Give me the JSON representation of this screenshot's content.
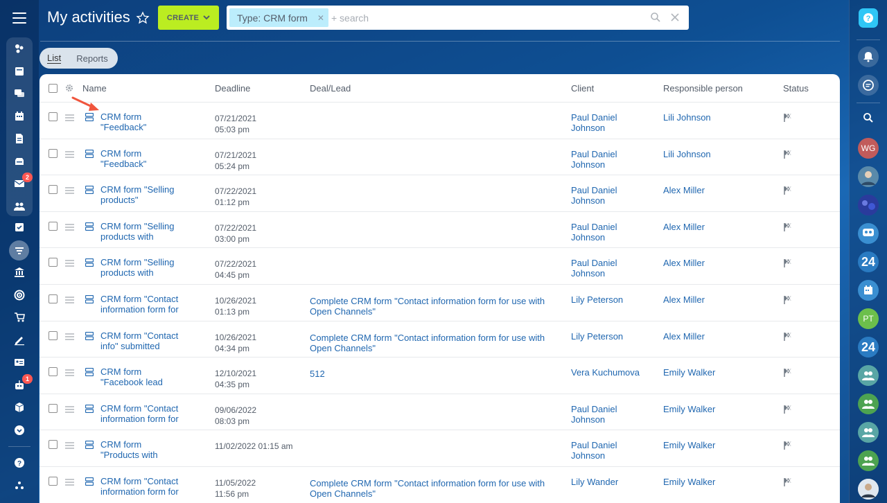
{
  "header": {
    "title": "My activities",
    "create_label": "CREATE",
    "filter_tag": "Type: CRM form",
    "search_placeholder": "+ search"
  },
  "view_tabs": [
    {
      "label": "List",
      "active": true
    },
    {
      "label": "Reports",
      "active": false
    }
  ],
  "columns": [
    "Name",
    "Deadline",
    "Deal/Lead",
    "Client",
    "Responsible person",
    "Status"
  ],
  "rows": [
    {
      "name": [
        "CRM form",
        "\"Feedback\""
      ],
      "deadline": [
        "07/21/2021",
        "05:03 pm"
      ],
      "deal": [
        "",
        ""
      ],
      "client": [
        "Paul Daniel",
        "Johnson"
      ],
      "responsible": "Lili Johnson"
    },
    {
      "name": [
        "CRM form",
        "\"Feedback\""
      ],
      "deadline": [
        "07/21/2021",
        "05:24 pm"
      ],
      "deal": [
        "",
        ""
      ],
      "client": [
        "Paul Daniel",
        "Johnson"
      ],
      "responsible": "Lili Johnson"
    },
    {
      "name": [
        "CRM form \"Selling",
        "products\""
      ],
      "deadline": [
        "07/22/2021",
        "01:12 pm"
      ],
      "deal": [
        "",
        ""
      ],
      "client": [
        "Paul Daniel",
        "Johnson"
      ],
      "responsible": "Alex Miller"
    },
    {
      "name": [
        "CRM form \"Selling",
        "products with"
      ],
      "deadline": [
        "07/22/2021",
        "03:00 pm"
      ],
      "deal": [
        "",
        ""
      ],
      "client": [
        "Paul Daniel",
        "Johnson"
      ],
      "responsible": "Alex Miller"
    },
    {
      "name": [
        "CRM form \"Selling",
        "products with"
      ],
      "deadline": [
        "07/22/2021",
        "04:45 pm"
      ],
      "deal": [
        "",
        ""
      ],
      "client": [
        "Paul Daniel",
        "Johnson"
      ],
      "responsible": "Alex Miller"
    },
    {
      "name": [
        "CRM form \"Contact",
        "information form for"
      ],
      "deadline": [
        "10/26/2021",
        "01:13 pm"
      ],
      "deal": [
        "Complete CRM form \"Contact information form for use with",
        "Open Channels\""
      ],
      "client": [
        "Lily Peterson",
        ""
      ],
      "responsible": "Alex Miller"
    },
    {
      "name": [
        "CRM form \"Contact",
        "info\" submitted"
      ],
      "deadline": [
        "10/26/2021",
        "04:34 pm"
      ],
      "deal": [
        "Complete CRM form \"Contact information form for use with",
        "Open Channels\""
      ],
      "client": [
        "Lily Peterson",
        ""
      ],
      "responsible": "Alex Miller"
    },
    {
      "name": [
        "CRM form",
        "\"Facebook lead"
      ],
      "deadline": [
        "12/10/2021",
        "04:35 pm"
      ],
      "deal": [
        "512",
        ""
      ],
      "client": [
        "Vera Kuchumova",
        ""
      ],
      "responsible": "Emily Walker"
    },
    {
      "name": [
        "CRM form \"Contact",
        "information form for"
      ],
      "deadline": [
        "09/06/2022",
        "08:03 pm"
      ],
      "deal": [
        "",
        ""
      ],
      "client": [
        "Paul Daniel",
        "Johnson"
      ],
      "responsible": "Emily Walker"
    },
    {
      "name": [
        "CRM form",
        "\"Products with"
      ],
      "deadline": [
        "11/02/2022 01:15 am",
        ""
      ],
      "deal": [
        "",
        ""
      ],
      "client": [
        "Paul Daniel",
        "Johnson"
      ],
      "responsible": "Emily Walker"
    },
    {
      "name": [
        "CRM form \"Contact",
        "information form for"
      ],
      "deadline": [
        "11/05/2022",
        "11:56 pm"
      ],
      "deal": [
        "Complete CRM form \"Contact information form for use with",
        "Open Channels\""
      ],
      "client": [
        "Lily Wander",
        ""
      ],
      "responsible": "Emily Walker"
    }
  ],
  "left_badges": {
    "mail": "2",
    "robot": "1"
  },
  "right_bar": {
    "avatar_wg": "WG",
    "avatar_pt": "PT",
    "b24_label": "24"
  },
  "colors": {
    "accent": "#bbed21",
    "link": "#2067b0",
    "filter_tag": "#bcedfc",
    "badge": "#ff5752"
  }
}
